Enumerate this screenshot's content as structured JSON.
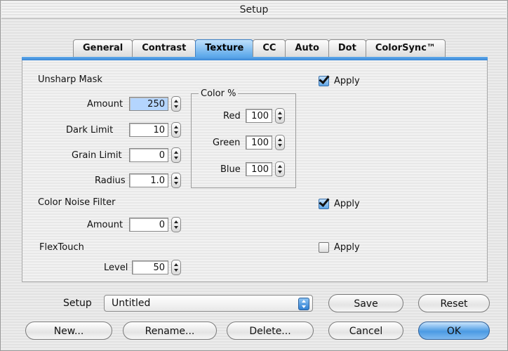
{
  "window": {
    "title": "Setup"
  },
  "tabs": [
    {
      "label": "General"
    },
    {
      "label": "Contrast"
    },
    {
      "label": "Texture"
    },
    {
      "label": "CC"
    },
    {
      "label": "Auto"
    },
    {
      "label": "Dot"
    },
    {
      "label": "ColorSync™"
    }
  ],
  "active_tab": "Texture",
  "unsharp_mask": {
    "heading": "Unsharp Mask",
    "amount_label": "Amount",
    "amount": "250",
    "dark_limit_label": "Dark Limit",
    "dark_limit": "10",
    "grain_limit_label": "Grain Limit",
    "grain_limit": "0",
    "radius_label": "Radius",
    "radius": "1.0",
    "apply_label": "Apply",
    "apply_checked": true
  },
  "color_percent": {
    "title": "Color %",
    "red_label": "Red",
    "red": "100",
    "green_label": "Green",
    "green": "100",
    "blue_label": "Blue",
    "blue": "100"
  },
  "color_noise_filter": {
    "heading": "Color Noise Filter",
    "amount_label": "Amount",
    "amount": "0",
    "apply_label": "Apply",
    "apply_checked": true
  },
  "flextouch": {
    "heading": "FlexTouch",
    "level_label": "Level",
    "level": "50",
    "apply_label": "Apply",
    "apply_checked": false
  },
  "footer": {
    "setup_label": "Setup",
    "setup_value": "Untitled",
    "save": "Save",
    "reset": "Reset",
    "new": "New...",
    "rename": "Rename...",
    "delete": "Delete...",
    "cancel": "Cancel",
    "ok": "OK"
  },
  "colors": {
    "accent": "#4b9ae3",
    "selection": "#b4d5fe"
  }
}
